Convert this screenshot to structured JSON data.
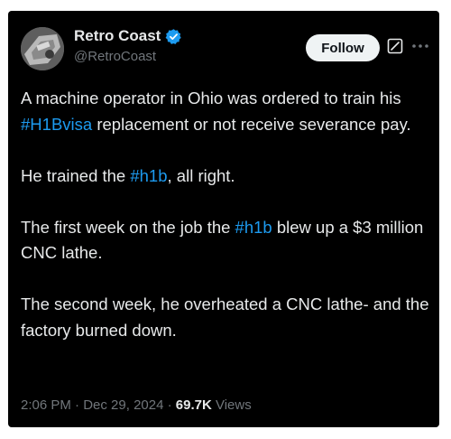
{
  "header": {
    "display_name": "Retro Coast",
    "handle": "@RetroCoast",
    "follow_label": "Follow"
  },
  "icons": {
    "verified": "verified-badge-icon",
    "grok": "grok-icon",
    "more": "more-options-icon"
  },
  "colors": {
    "background": "#000000",
    "text": "#e7e9ea",
    "secondary": "#71767b",
    "hashtag": "#1d9bf0",
    "follow_bg": "#eff3f4"
  },
  "tweet": {
    "p1_a": "A machine operator in Ohio was ordered to train his ",
    "p1_tag": "#H1Bvisa",
    "p1_b": " replacement or not receive severance pay.",
    "p2_a": "He trained the ",
    "p2_tag": "#h1b",
    "p2_b": ", all right.",
    "p3_a": "The first week on the job the ",
    "p3_tag": "#h1b",
    "p3_b": " blew up a $3 million CNC lathe.",
    "p4": "The second week, he overheated a CNC lathe- and the factory burned down."
  },
  "meta": {
    "time": "2:06 PM",
    "sep1": " · ",
    "date": "Dec 29, 2024",
    "sep2": " · ",
    "views_count": "69.7K",
    "views_label": " Views"
  }
}
